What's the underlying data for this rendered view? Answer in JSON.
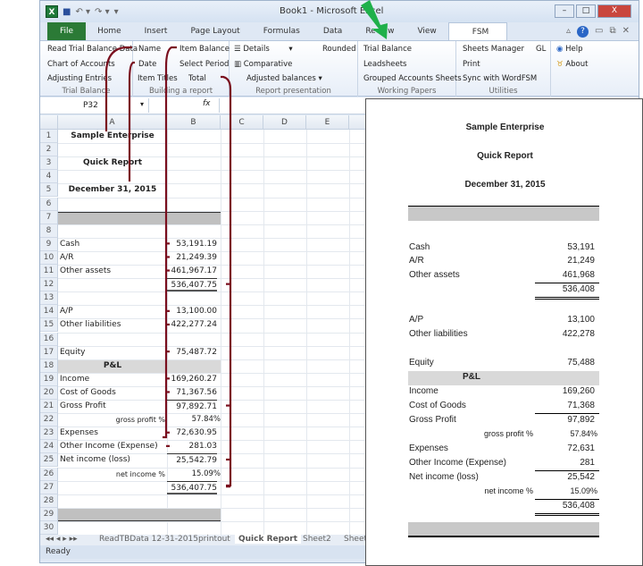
{
  "window": {
    "title": "Book1 - Microsoft Excel",
    "app_icon": "X",
    "controls": [
      "–",
      "□",
      "X"
    ]
  },
  "tabs": [
    "File",
    "Home",
    "Insert",
    "Page Layout",
    "Formulas",
    "Data",
    "Review",
    "View",
    "FSM"
  ],
  "active_tab": "FSM",
  "ribbon": {
    "trial_balance": {
      "label": "Trial Balance",
      "items": [
        "Read Trial Balance Data",
        "Chart of Accounts",
        "Adjusting Entries"
      ]
    },
    "building": {
      "label": "Building a report",
      "items": [
        "Name",
        "Date",
        "Item Titles",
        "Item Balance",
        "Select Period",
        "Total"
      ]
    },
    "presentation": {
      "label": "Report presentation",
      "items": [
        "Details",
        "Rounded",
        "Comparative",
        "Adjusted balances"
      ]
    },
    "working": {
      "label": "Working Papers",
      "items": [
        "Trial Balance",
        "Leadsheets",
        "Grouped Accounts Sheets"
      ]
    },
    "utilities": {
      "label": "Utilities",
      "items": [
        "Sheets Manager",
        "GL",
        "Print",
        "Sync with WordFSM"
      ]
    },
    "help": {
      "items": [
        "Help",
        "About"
      ]
    }
  },
  "formula_bar": {
    "name_box": "P32",
    "fx": "fx",
    "value": ""
  },
  "columns": [
    "A",
    "B",
    "C",
    "D",
    "E"
  ],
  "sheet": {
    "rows": [
      {
        "n": 1,
        "a": "Sample Enterprise",
        "b": "",
        "style": "title"
      },
      {
        "n": 2,
        "a": "",
        "b": ""
      },
      {
        "n": 3,
        "a": "Quick Report",
        "b": "",
        "style": "title"
      },
      {
        "n": 4,
        "a": "",
        "b": ""
      },
      {
        "n": 5,
        "a": "December 31, 2015",
        "b": "",
        "style": "title"
      },
      {
        "n": 6,
        "a": "",
        "b": ""
      },
      {
        "n": 7,
        "a": "",
        "b": "",
        "style": "band"
      },
      {
        "n": 8,
        "a": "",
        "b": ""
      },
      {
        "n": 9,
        "a": "Cash",
        "b": "53,191.19"
      },
      {
        "n": 10,
        "a": "A/R",
        "b": "21,249.39"
      },
      {
        "n": 11,
        "a": "Other assets",
        "b": "461,967.17"
      },
      {
        "n": 12,
        "a": "",
        "b": "536,407.75",
        "style": "total"
      },
      {
        "n": 13,
        "a": "",
        "b": ""
      },
      {
        "n": 14,
        "a": "A/P",
        "b": "13,100.00"
      },
      {
        "n": 15,
        "a": "Other liabilities",
        "b": "422,277.24"
      },
      {
        "n": 16,
        "a": "",
        "b": ""
      },
      {
        "n": 17,
        "a": "Equity",
        "b": "75,487.72"
      },
      {
        "n": 18,
        "a": "P&L",
        "b": "",
        "style": "pl"
      },
      {
        "n": 19,
        "a": "Income",
        "b": "169,260.27"
      },
      {
        "n": 20,
        "a": "Cost of Goods",
        "b": "71,367.56"
      },
      {
        "n": 21,
        "a": "Gross Profit",
        "b": "97,892.71",
        "style": "topline"
      },
      {
        "n": 22,
        "a": "gross profit %",
        "b": "57.84%",
        "style": "pct"
      },
      {
        "n": 23,
        "a": "Expenses",
        "b": "72,630.95"
      },
      {
        "n": 24,
        "a": "Other Income (Expense)",
        "b": "281.03"
      },
      {
        "n": 25,
        "a": "Net income (loss)",
        "b": "25,542.79",
        "style": "topline"
      },
      {
        "n": 26,
        "a": "net income %",
        "b": "15.09%",
        "style": "pct"
      },
      {
        "n": 27,
        "a": "",
        "b": "536,407.75",
        "style": "total"
      },
      {
        "n": 28,
        "a": "",
        "b": ""
      },
      {
        "n": 29,
        "a": "",
        "b": "",
        "style": "band"
      },
      {
        "n": 30,
        "a": "",
        "b": ""
      }
    ]
  },
  "sheet_tabs": [
    "ReadTBData 12-31-2015printout",
    "Quick Report",
    "Sheet2",
    "Sheet"
  ],
  "active_sheet": "Quick Report",
  "status": "Ready",
  "preview": {
    "company": "Sample Enterprise",
    "report": "Quick Report",
    "date": "December 31, 2015",
    "lines": [
      {
        "label": "Cash",
        "value": "53,191"
      },
      {
        "label": "A/R",
        "value": "21,249"
      },
      {
        "label": "Other assets",
        "value": "461,968",
        "under": "single"
      },
      {
        "label": "",
        "value": "536,408",
        "under": "double"
      },
      {
        "label": "A/P",
        "value": "13,100"
      },
      {
        "label": "Other liabilities",
        "value": "422,278"
      },
      {
        "label": "Equity",
        "value": "75,488"
      },
      {
        "label": "P&L",
        "value": "",
        "style": "pl"
      },
      {
        "label": "Income",
        "value": "169,260"
      },
      {
        "label": "Cost of Goods",
        "value": "71,368",
        "under": "single"
      },
      {
        "label": "Gross Profit",
        "value": "97,892"
      },
      {
        "label": "gross profit %",
        "value": "57.84%",
        "style": "pct"
      },
      {
        "label": "Expenses",
        "value": "72,631"
      },
      {
        "label": "Other Income (Expense)",
        "value": "281",
        "under": "single"
      },
      {
        "label": "Net income (loss)",
        "value": "25,542"
      },
      {
        "label": "net income %",
        "value": "15.09%",
        "style": "pct",
        "under": "single"
      },
      {
        "label": "",
        "value": "536,408",
        "under": "double"
      }
    ]
  },
  "colors": {
    "file_tab": "#2b7a36",
    "annotation": "#7a0f1e",
    "arrow": "#1fb04a",
    "band": "#c8c8c8"
  }
}
